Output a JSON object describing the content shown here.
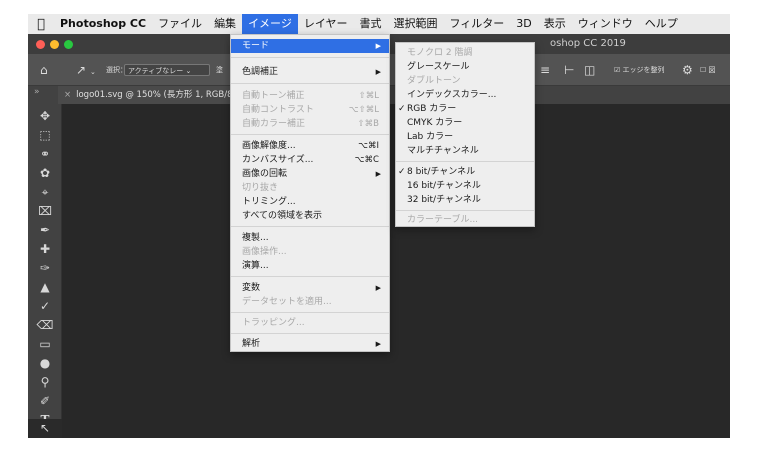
{
  "menubar": {
    "items": [
      "Photoshop CC",
      "ファイル",
      "編集",
      "イメージ",
      "レイヤー",
      "書式",
      "選択範囲",
      "フィルター",
      "3D",
      "表示",
      "ウィンドウ",
      "ヘルプ"
    ]
  },
  "titlebar": {
    "title": "oshop CC 2019"
  },
  "options": {
    "select_label": "選択：",
    "select_value": "アクティブなレー",
    "truncated_label": "塗",
    "edge_label": "エッジを整列",
    "extra_label": "図"
  },
  "document": {
    "tab_title": "logo01.svg @ 150% (長方形 1, RGB/8"
  },
  "image_menu": {
    "mode": "モード",
    "adjust": "色調補正",
    "auto_tone": "自動トーン補正",
    "auto_tone_sc": "⇧⌘L",
    "auto_contrast": "自動コントラスト",
    "auto_contrast_sc": "⌥⇧⌘L",
    "auto_color": "自動カラー補正",
    "auto_color_sc": "⇧⌘B",
    "image_size": "画像解像度...",
    "image_size_sc": "⌥⌘I",
    "canvas_size": "カンバスサイズ...",
    "canvas_size_sc": "⌥⌘C",
    "rotate": "画像の回転",
    "crop": "切り抜き",
    "trim": "トリミング...",
    "reveal_all": "すべての領域を表示",
    "duplicate": "複製...",
    "apply_image": "画像操作...",
    "calculations": "演算...",
    "variables": "変数",
    "apply_dataset": "データセットを適用...",
    "trap": "トラッピング...",
    "analysis": "解析"
  },
  "mode_menu": {
    "bitmap": "モノクロ 2 階調",
    "grayscale": "グレースケール",
    "duotone": "ダブルトーン",
    "indexed": "インデックスカラー...",
    "rgb": "RGB カラー",
    "cmyk": "CMYK カラー",
    "lab": "Lab カラー",
    "multichannel": "マルチチャンネル",
    "bit8": "8 bit/チャンネル",
    "bit16": "16 bit/チャンネル",
    "bit32": "32 bit/チャンネル",
    "color_table": "カラーテーブル..."
  },
  "colors": {
    "highlight": "#2f6fe4",
    "menubar": "#eaeaea",
    "canvas": "#282828",
    "panel": "#424242"
  }
}
